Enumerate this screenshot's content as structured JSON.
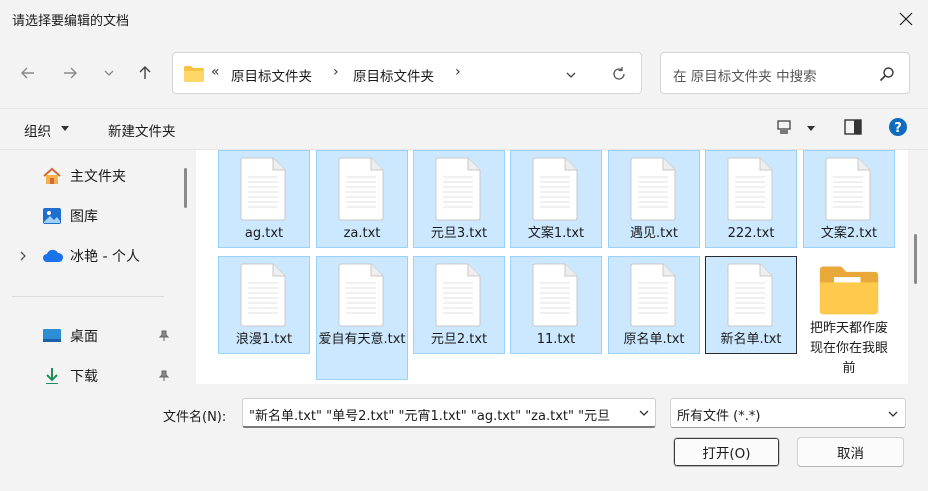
{
  "window": {
    "title": "请选择要编辑的文档"
  },
  "address": {
    "overflow": "«",
    "crumbs": [
      "原目标文件夹",
      "原目标文件夹"
    ]
  },
  "search": {
    "placeholder": "在 原目标文件夹 中搜索"
  },
  "toolbar": {
    "organize": "组织",
    "new_folder": "新建文件夹"
  },
  "sidebar": {
    "items": [
      {
        "label": "主文件夹",
        "icon": "home-icon"
      },
      {
        "label": "图库",
        "icon": "gallery-icon"
      },
      {
        "label": "冰艳 - 个人",
        "icon": "cloud-icon"
      },
      {
        "label": "桌面",
        "icon": "desktop-icon"
      },
      {
        "label": "下载",
        "icon": "download-icon"
      }
    ]
  },
  "files": [
    {
      "name": "ag.txt",
      "selected": true
    },
    {
      "name": "za.txt",
      "selected": true
    },
    {
      "name": "元旦3.txt",
      "selected": true
    },
    {
      "name": "文案1.txt",
      "selected": true
    },
    {
      "name": "遇见.txt",
      "selected": true
    },
    {
      "name": "222.txt",
      "selected": true
    },
    {
      "name": "文案2.txt",
      "selected": true
    },
    {
      "name": "浪漫1.txt",
      "selected": true
    },
    {
      "name": "爱自有天意.txt",
      "selected": true
    },
    {
      "name": "元旦2.txt",
      "selected": true
    },
    {
      "name": "11.txt",
      "selected": true
    },
    {
      "name": "原名单.txt",
      "selected": true
    },
    {
      "name": "新名单.txt",
      "selected": true
    },
    {
      "name": "把昨天都作废现在你在我眼前",
      "selected": false,
      "folder": true
    }
  ],
  "filename": {
    "label": "文件名(N):",
    "value": "\"新名单.txt\" \"单号2.txt\" \"元宵1.txt\" \"ag.txt\" \"za.txt\" \"元旦"
  },
  "filetype": {
    "value": "所有文件 (*.*)"
  },
  "buttons": {
    "open": "打开(O)",
    "cancel": "取消"
  },
  "colors": {
    "selection": "#cce8ff",
    "selection_border": "#99d1ff",
    "accent": "#0067c0"
  }
}
